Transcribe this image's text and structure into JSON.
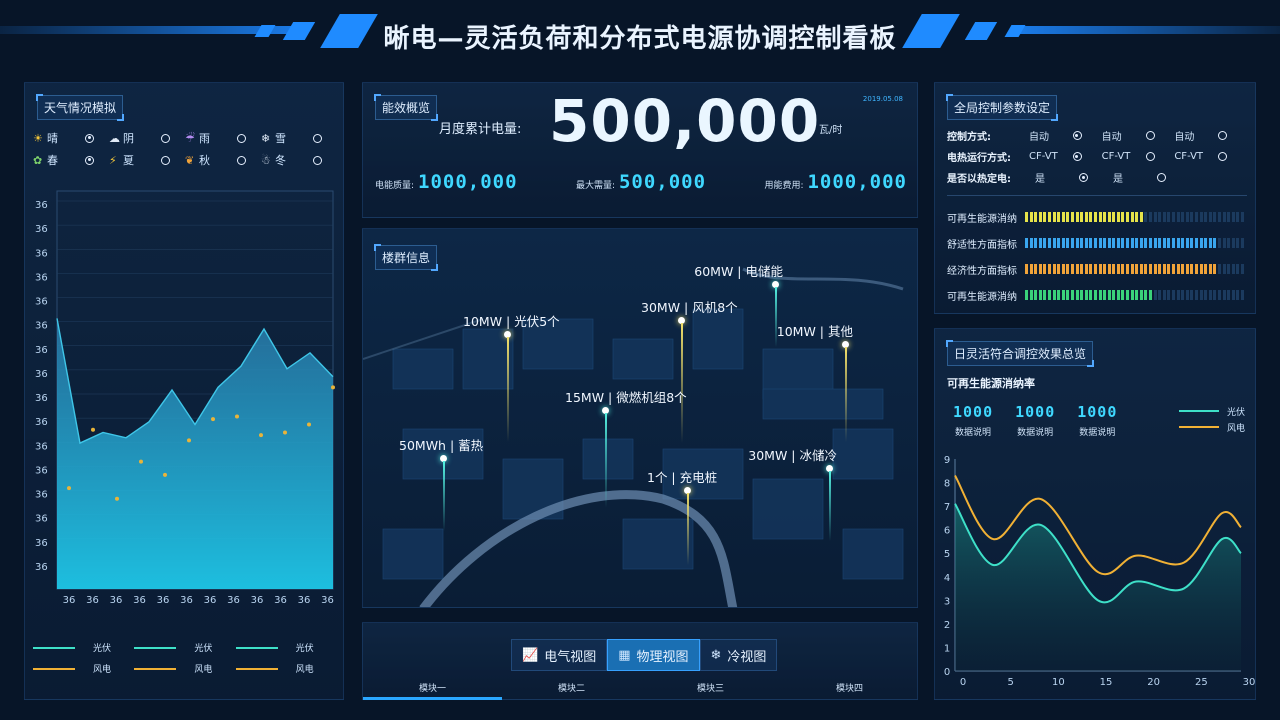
{
  "header": {
    "title": "晰电—灵活负荷和分布式电源协调控制看板"
  },
  "weather": {
    "title": "天气情况模拟",
    "rows": [
      [
        {
          "icon": "sun-icon",
          "glyph": "☀",
          "label": "晴",
          "on": true
        },
        {
          "icon": "cloud-icon",
          "glyph": "☁",
          "label": "阴",
          "on": false
        },
        {
          "icon": "rain-icon",
          "glyph": "☔",
          "label": "雨",
          "on": false
        },
        {
          "icon": "snow-icon",
          "glyph": "❄",
          "label": "雪",
          "on": false
        }
      ],
      [
        {
          "icon": "sprout-icon",
          "glyph": "✿",
          "label": "春",
          "on": true
        },
        {
          "icon": "lightning-icon",
          "glyph": "⚡",
          "label": "夏",
          "on": false
        },
        {
          "icon": "leaf-icon",
          "glyph": "❦",
          "label": "秋",
          "on": false
        },
        {
          "icon": "snowman-icon",
          "glyph": "☃",
          "label": "冬",
          "on": false
        }
      ]
    ],
    "legend": [
      {
        "name": "光伏"
      },
      {
        "name": "光伏"
      },
      {
        "name": "光伏"
      },
      {
        "name": "风电"
      },
      {
        "name": "风电"
      },
      {
        "name": "风电"
      }
    ]
  },
  "chart_data": [
    {
      "type": "area",
      "xlabel": "",
      "ylabel": "",
      "x_tick_labels": [
        "36",
        "36",
        "36",
        "36",
        "36",
        "36",
        "36",
        "36",
        "36",
        "36",
        "36",
        "36"
      ],
      "y_tick_labels": [
        "36",
        "36",
        "36",
        "36",
        "36",
        "36",
        "36",
        "36",
        "36",
        "36",
        "36",
        "36",
        "36",
        "36",
        "36",
        "36"
      ],
      "series": [
        {
          "name": "光伏",
          "kind": "area",
          "color": "#3fc6e8",
          "values": [
            10.2,
            5.5,
            5.9,
            5.7,
            6.3,
            7.5,
            6.2,
            7.6,
            8.4,
            9.8,
            8.3,
            8.9,
            8.0
          ]
        },
        {
          "name": "风电",
          "kind": "scatter",
          "color": "#e8b43a",
          "values": [
            3.8,
            6.0,
            3.4,
            4.8,
            4.3,
            5.6,
            6.4,
            6.5,
            5.8,
            5.9,
            6.2,
            7.6
          ]
        }
      ],
      "ylim": [
        0,
        15
      ]
    },
    {
      "type": "line",
      "xlim": [
        0,
        30
      ],
      "ylim": [
        0,
        9
      ],
      "x_ticks": [
        0,
        5,
        10,
        15,
        20,
        25,
        30
      ],
      "y_ticks": [
        0,
        1,
        2,
        3,
        4,
        5,
        6,
        7,
        8,
        9
      ],
      "series": [
        {
          "name": "光伏",
          "color": "#3ee0c8",
          "x": [
            0,
            4,
            9,
            15,
            19,
            24,
            28,
            30
          ],
          "values": [
            7.1,
            4.5,
            6.2,
            3.0,
            3.8,
            3.5,
            5.6,
            5.0
          ]
        },
        {
          "name": "风电",
          "color": "#f1b135",
          "x": [
            0,
            4,
            9,
            15,
            19,
            24,
            28,
            30
          ],
          "values": [
            8.3,
            5.6,
            7.3,
            4.2,
            4.9,
            4.6,
            6.7,
            6.1
          ]
        }
      ]
    }
  ],
  "efficiency": {
    "title": "能效概览",
    "monthly_label": "月度累计电量:",
    "monthly_value": "500,000",
    "monthly_unit": "瓦/时",
    "date": "2019.05.08",
    "stats": [
      {
        "label": "电能质量:",
        "value": "1000,000"
      },
      {
        "label": "最大需量:",
        "value": "500,000"
      },
      {
        "label": "用能费用:",
        "value": "1000,000"
      }
    ]
  },
  "buildings": {
    "title": "楼群信息",
    "markers": [
      {
        "label": "60MW | 电储能"
      },
      {
        "label": "10MW | 光伏5个"
      },
      {
        "label": "30MW | 风机8个"
      },
      {
        "label": "10MW | 其他"
      },
      {
        "label": "15MW | 微燃机组8个"
      },
      {
        "label": "50MWh | 蓄热"
      },
      {
        "label": "30MW | 冰储冷"
      },
      {
        "label": "1个 | 充电桩"
      }
    ]
  },
  "views": {
    "tabs": [
      {
        "label": "电气视图",
        "icon": "chart-icon",
        "active": false
      },
      {
        "label": "物理视图",
        "icon": "grid-icon",
        "active": true
      },
      {
        "label": "冷视图",
        "icon": "snowflake-icon",
        "active": false
      }
    ],
    "modules": [
      "模块一",
      "模块二",
      "模块三",
      "模块四"
    ]
  },
  "control": {
    "title": "全局控制参数设定",
    "rows": [
      {
        "label": "控制方式:",
        "opts": [
          {
            "t": "自动",
            "on": true
          },
          {
            "t": "自动",
            "on": false
          },
          {
            "t": "自动",
            "on": false
          }
        ]
      },
      {
        "label": "电热运行方式:",
        "opts": [
          {
            "t": "CF-VT",
            "on": true
          },
          {
            "t": "CF-VT",
            "on": false
          },
          {
            "t": "CF-VT",
            "on": false
          }
        ]
      },
      {
        "label": "是否以热定电:",
        "opts": [
          {
            "t": "是",
            "on": true
          },
          {
            "t": "是",
            "on": false
          }
        ]
      }
    ],
    "meters": [
      {
        "label": "可再生能源消纳",
        "color": "#e6e34a",
        "level": 0.55
      },
      {
        "label": "舒适性方面指标",
        "color": "#3aa6ef",
        "level": 0.88
      },
      {
        "label": "经济性方面指标",
        "color": "#f0a33a",
        "level": 0.88
      },
      {
        "label": "可再生能源消纳",
        "color": "#3ad27a",
        "level": 0.58
      }
    ]
  },
  "daily": {
    "title": "日灵活符合调控效果总览",
    "subtitle": "可再生能源消纳率",
    "stats": [
      {
        "value": "1000",
        "label": "数据说明"
      },
      {
        "value": "1000",
        "label": "数据说明"
      },
      {
        "value": "1000",
        "label": "数据说明"
      }
    ],
    "legend": [
      {
        "name": "光伏",
        "color": "#3ee0c8"
      },
      {
        "name": "风电",
        "color": "#f1b135"
      }
    ]
  }
}
